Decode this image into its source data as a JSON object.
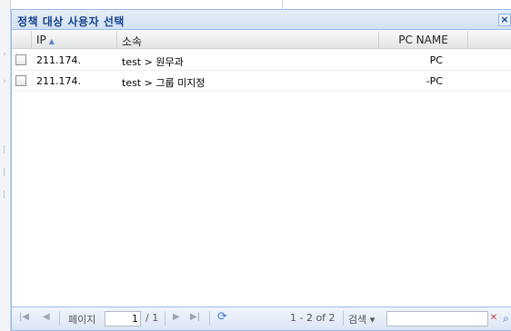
{
  "dialog": {
    "title": "정책 대상 사용자 선택",
    "close_icon": "close-icon"
  },
  "grid": {
    "columns": [
      "IP",
      "소속",
      "PC NAME",
      ""
    ],
    "sort_column": "IP",
    "sort_direction": "asc",
    "rows": [
      {
        "ip": "211.174.",
        "dept": "test > 원무과",
        "pc": "PC",
        "checked": false
      },
      {
        "ip": "211.174.",
        "dept": "test > 그룹 미지정",
        "pc": "-PC",
        "checked": false
      }
    ]
  },
  "paging": {
    "page_label": "페이지",
    "current_page": "1",
    "total_pages": "/ 1",
    "summary": "1 - 2 of 2",
    "search_label": "검색 ▾",
    "search_value": ""
  },
  "colors": {
    "accent": "#99bbe8",
    "title_text": "#15428b"
  }
}
